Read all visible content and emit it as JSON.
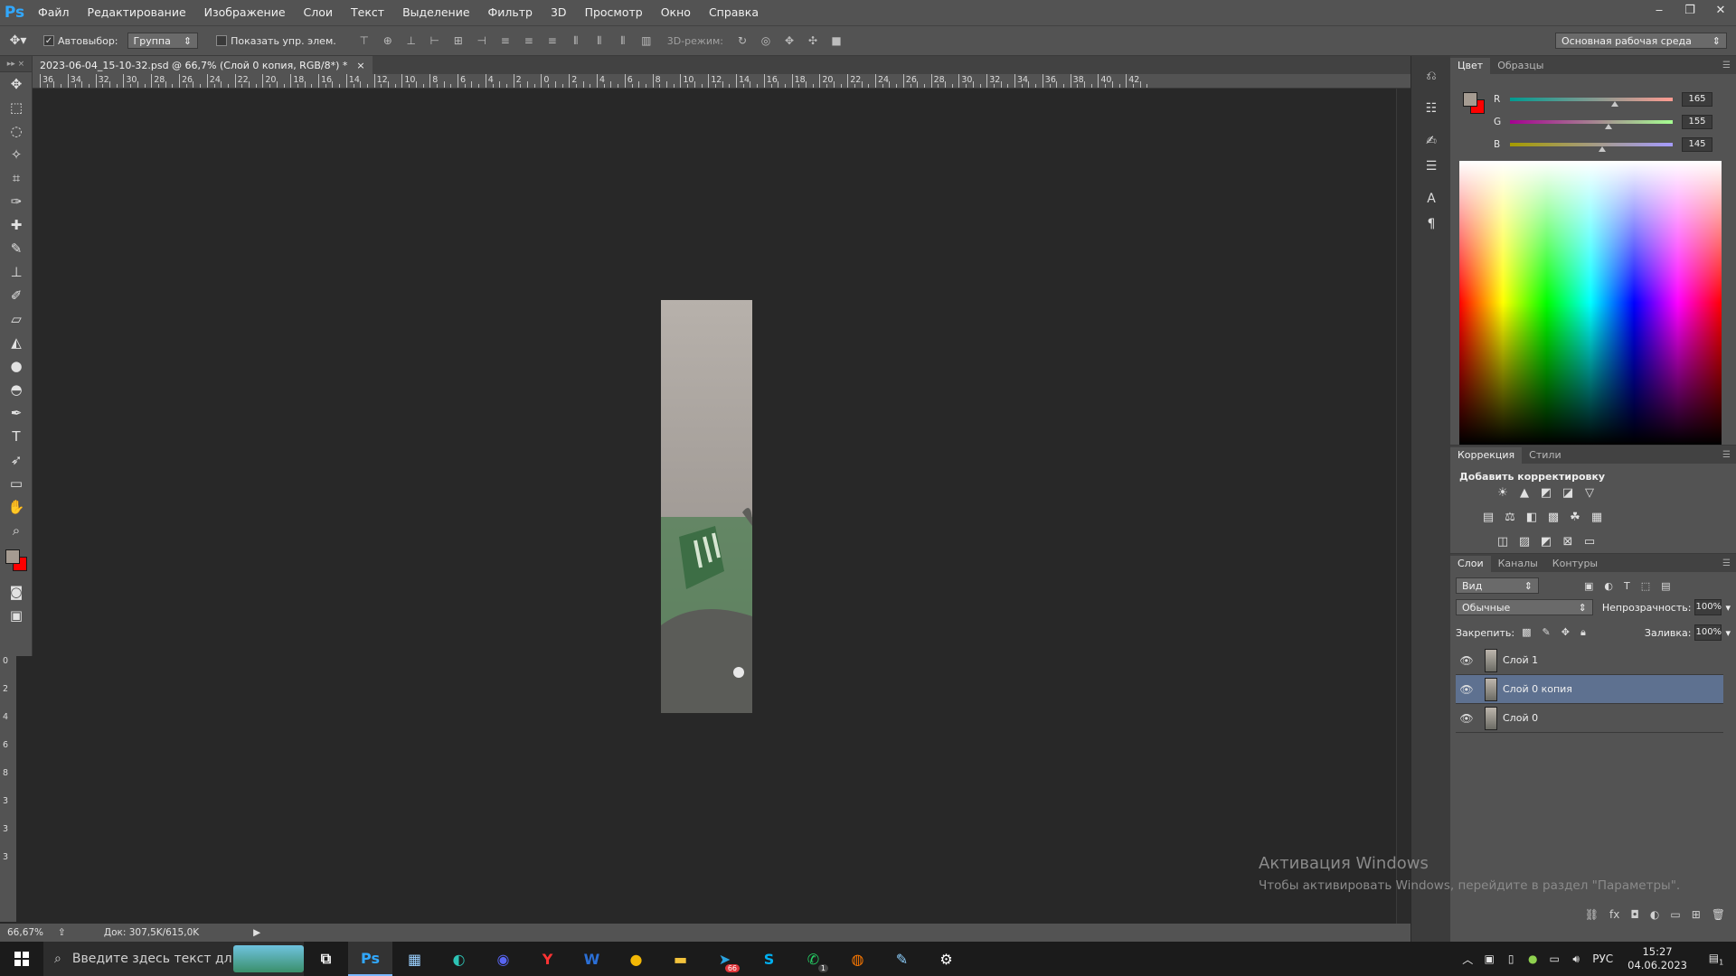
{
  "app": {
    "logo": "Ps"
  },
  "menu": [
    "Файл",
    "Редактирование",
    "Изображение",
    "Слои",
    "Текст",
    "Выделение",
    "Фильтр",
    "3D",
    "Просмотр",
    "Окно",
    "Справка"
  ],
  "window_controls": {
    "minimize": "‒",
    "restore": "❐",
    "close": "✕"
  },
  "options": {
    "autoselect_label": "Автовыбор:",
    "autoselect_checked": true,
    "autoselect_value": "Группа",
    "show_transform_label": "Показать упр. элем.",
    "show_transform_checked": false,
    "mode_3d_label": "3D-режим:",
    "workspace": "Основная рабочая среда"
  },
  "document": {
    "tab_title": "2023-06-04_15-10-32.psd @ 66,7% (Слой 0 копия, RGB/8*) *",
    "close_glyph": "×"
  },
  "ruler_top_labels": [
    "36",
    "34",
    "32",
    "30",
    "28",
    "26",
    "24",
    "22",
    "20",
    "18",
    "16",
    "14",
    "12",
    "10",
    "8",
    "6",
    "4",
    "2",
    "0",
    "2",
    "4",
    "6",
    "8",
    "10",
    "12",
    "14",
    "16",
    "18",
    "20",
    "22",
    "24",
    "26",
    "28",
    "30",
    "32",
    "34",
    "36",
    "38",
    "40",
    "42"
  ],
  "ruler_left_labels": [
    "0",
    "2",
    "4",
    "6",
    "8",
    "3",
    "3",
    "3"
  ],
  "status": {
    "zoom": "66,67%",
    "doc_info": "Док: 307,5K/615,0K"
  },
  "color_panel": {
    "tabs": [
      "Цвет",
      "Образцы"
    ],
    "foreground": "#a59b91",
    "background": "#ff0000",
    "channels": [
      {
        "name": "R",
        "value": "165",
        "fraction": 0.647
      },
      {
        "name": "G",
        "value": "155",
        "fraction": 0.608
      },
      {
        "name": "B",
        "value": "145",
        "fraction": 0.569
      }
    ]
  },
  "adjust_panel": {
    "tabs": [
      "Коррекция",
      "Стили"
    ],
    "title": "Добавить корректировку"
  },
  "layers_panel": {
    "tabs": [
      "Слои",
      "Каналы",
      "Контуры"
    ],
    "filter_kind": "Вид",
    "blend_mode": "Обычные",
    "opacity_label": "Непрозрачность:",
    "opacity_value": "100%",
    "lock_label": "Закрепить:",
    "fill_label": "Заливка:",
    "fill_value": "100%",
    "layers": [
      {
        "name": "Слой 1",
        "selected": false
      },
      {
        "name": "Слой 0 копия",
        "selected": true
      },
      {
        "name": "Слой 0",
        "selected": false
      }
    ]
  },
  "watermark": {
    "line1": "Активация Windows",
    "line2": "Чтобы активировать Windows, перейдите в раздел \"Параметры\"."
  },
  "taskbar": {
    "search_placeholder": "Введите здесь текст дл...",
    "apps": [
      {
        "name": "task-view",
        "glyph": "⧉",
        "color": "#ffffff"
      },
      {
        "name": "photoshop",
        "glyph": "Ps",
        "color": "#31a8ff"
      },
      {
        "name": "calculator",
        "glyph": "▦",
        "color": "#9ad0ff"
      },
      {
        "name": "edge",
        "glyph": "◐",
        "color": "#2dc3b5"
      },
      {
        "name": "discord",
        "glyph": "◉",
        "color": "#5865f2"
      },
      {
        "name": "yandex-browser",
        "glyph": "Y",
        "color": "#ff3333"
      },
      {
        "name": "word",
        "glyph": "W",
        "color": "#2b6fd6"
      },
      {
        "name": "chrome",
        "glyph": "●",
        "color": "#f2b705"
      },
      {
        "name": "file-explorer",
        "glyph": "▬",
        "color": "#f3c33c"
      },
      {
        "name": "telegram",
        "glyph": "➤",
        "color": "#2aa3e0"
      },
      {
        "name": "skype",
        "glyph": "S",
        "color": "#00aff0"
      },
      {
        "name": "whatsapp",
        "glyph": "✆",
        "color": "#25d366"
      },
      {
        "name": "media-player",
        "glyph": "◍",
        "color": "#ff7a00"
      },
      {
        "name": "paint",
        "glyph": "✎",
        "color": "#8fd1ff"
      },
      {
        "name": "settings",
        "glyph": "⚙",
        "color": "#ffffff"
      }
    ],
    "telegram_badge": "66",
    "whatsapp_badge": "1",
    "language": "РУС",
    "time": "15:27",
    "date": "04.06.2023",
    "notification_count": "1"
  }
}
